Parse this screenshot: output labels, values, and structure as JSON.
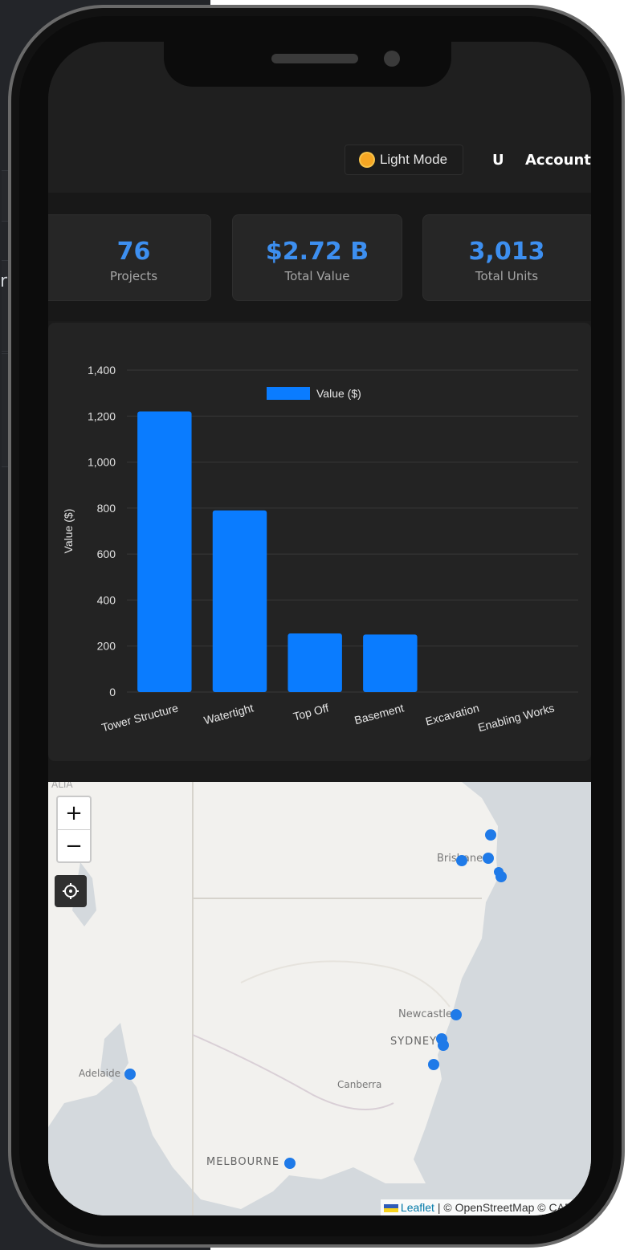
{
  "background": {
    "partial_letter": "r"
  },
  "header": {
    "mode_button_label": "Light Mode",
    "mode_icon": "sun-icon",
    "user_initial": "U",
    "account_label": "Account"
  },
  "stats": [
    {
      "value": "76",
      "label": "Projects"
    },
    {
      "value": "$2.72 B",
      "label": "Total Value"
    },
    {
      "value": "3,013",
      "label": "Total Units"
    }
  ],
  "chart_data": {
    "type": "bar",
    "categories": [
      "Tower Structure",
      "Watertight",
      "Top Off",
      "Basement",
      "Excavation",
      "Enabling Works"
    ],
    "series": [
      {
        "name": "Value ($)",
        "values": [
          1220,
          790,
          255,
          250,
          0,
          0
        ],
        "color": "#0a7cff"
      }
    ],
    "ylabel": "Value ($)",
    "ylim": [
      0,
      1400
    ],
    "yticks": [
      "0",
      "200",
      "400",
      "600",
      "800",
      "1,000",
      "1,200",
      "1,400"
    ],
    "legend_position": "top",
    "grid": true
  },
  "map": {
    "zoom_in": "+",
    "zoom_out": "−",
    "locate_icon": "crosshair-icon",
    "city_labels": [
      "ALIA",
      "Brisbane",
      "Newcastle",
      "SYDNEY",
      "Canberra",
      "Adelaide",
      "MELBOURNE"
    ],
    "attribution_link": "Leaflet",
    "attribution_text": " | © OpenStreetMap © CARTO",
    "marker_color": "#1f7ae8",
    "sea_color": "#d4d9dd",
    "land_color": "#f2f1ee"
  }
}
